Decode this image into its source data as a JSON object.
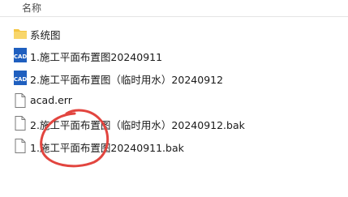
{
  "header": {
    "name_col": "名称"
  },
  "files": [
    {
      "name": "系统图",
      "icon": "folder-icon"
    },
    {
      "name": "1.施工平面布置图20240911",
      "icon": "cad-file-icon"
    },
    {
      "name": "2.施工平面布置图（临时用水）20240912",
      "icon": "cad-file-icon"
    },
    {
      "name": "acad.err",
      "icon": "document-icon"
    },
    {
      "name": "2.施工平面布置图（临时用水）20240912.bak",
      "icon": "document-icon"
    },
    {
      "name": "1.施工平面布置图20240911.bak",
      "icon": "document-icon"
    }
  ],
  "colors": {
    "folder": "#f4c542",
    "cad_blue": "#1f5fbf",
    "annotation": "#e2453f"
  }
}
